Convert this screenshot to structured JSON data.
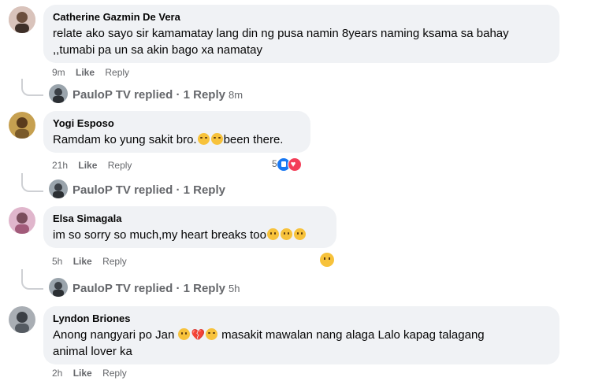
{
  "comments": [
    {
      "author": "Catherine Gazmin De Vera",
      "text_line1": "relate ako sayo sir kamamatay lang din ng pusa namin 8years naming ksama sa bahay",
      "text_line2": ",,tumabi pa un sa akin bago xa namatay",
      "time": "9m",
      "like": "Like",
      "reply": "Reply",
      "replies": {
        "author": "PauloP TV",
        "label": "replied · 1 Reply",
        "time": "8m"
      },
      "avatar_color": "#c9a7a0"
    },
    {
      "author": "Yogi Esposo",
      "text_before": "Ramdam ko yung sakit bro.",
      "text_after": "been there.",
      "emojis": [
        "loudly-crying-face-emoji",
        "loudly-crying-face-emoji"
      ],
      "time": "21h",
      "like": "Like",
      "reply": "Reply",
      "reaction_count": "5",
      "reactions": [
        "like-reaction-icon",
        "love-reaction-icon"
      ],
      "replies": {
        "author": "PauloP TV",
        "label": "replied · 1 Reply",
        "time": ""
      },
      "avatar_color": "#b08a3a"
    },
    {
      "author": "Elsa Simagala",
      "text_before": "im so sorry so much,my heart breaks too",
      "emojis": [
        "sad-face-emoji",
        "sad-face-emoji",
        "sad-face-emoji"
      ],
      "time": "5h",
      "like": "Like",
      "reply": "Reply",
      "reactions": [
        "sad-reaction-icon"
      ],
      "replies": {
        "author": "PauloP TV",
        "label": "replied · 1 Reply",
        "time": "5h"
      },
      "avatar_color": "#d6a3c0"
    },
    {
      "author": "Lyndon Briones",
      "text_before": "Anong nangyari po Jan",
      "text_after": "masakit mawalan nang alaga Lalo kapag talagang",
      "text_line2": "animal lover ka",
      "emojis": [
        "sad-face-emoji",
        "broken-heart-emoji",
        "loudly-crying-face-emoji"
      ],
      "time": "2h",
      "like": "Like",
      "reply": "Reply",
      "avatar_color": "#8a8f96"
    }
  ]
}
